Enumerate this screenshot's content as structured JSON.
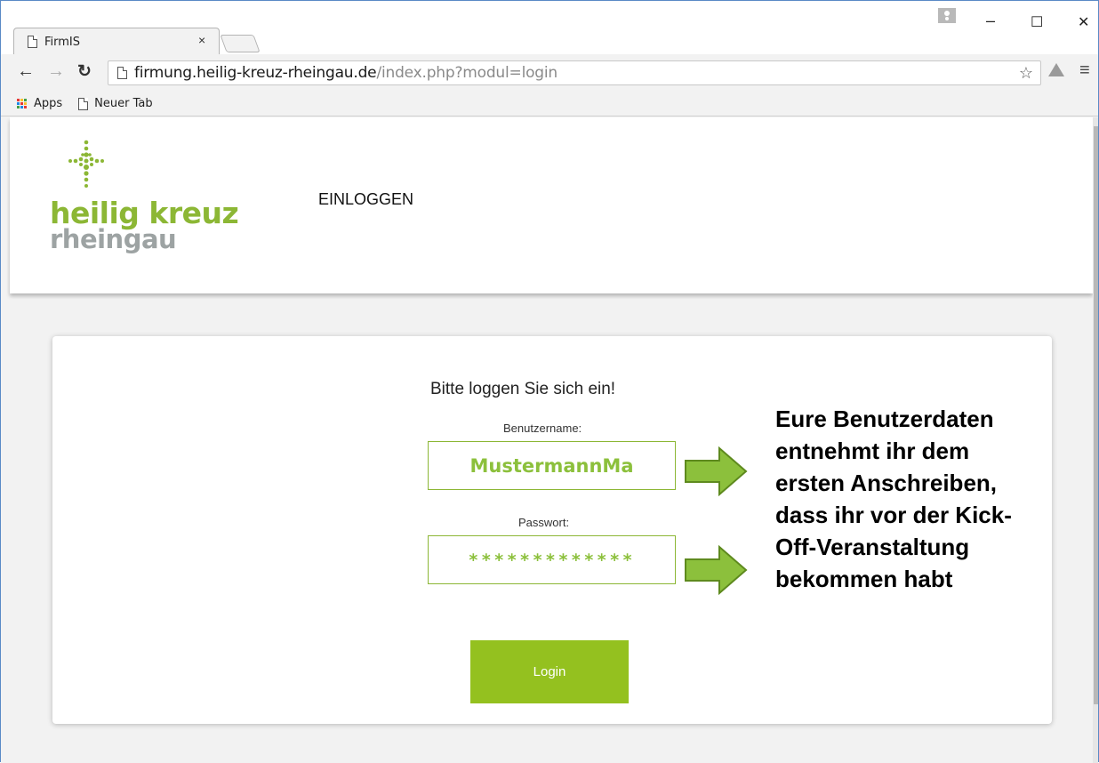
{
  "browser": {
    "tab_title": "FirmIS",
    "tab_close": "×",
    "window_controls": {
      "minimize": "–",
      "maximize": "☐",
      "close": "✕"
    },
    "url_host": "firmung.heilig-kreuz-rheingau.de",
    "url_path": "/index.php?modul=login",
    "bookmarks": [
      {
        "label": "Apps",
        "icon": "apps-grid-icon"
      },
      {
        "label": "Neuer Tab",
        "icon": "page-icon"
      }
    ],
    "apps_colors": [
      "#e53935",
      "#fbc02d",
      "#43a047",
      "#1e88e5",
      "#e53935",
      "#fbc02d",
      "#43a047",
      "#1e88e5",
      "#e53935"
    ]
  },
  "site": {
    "logo_line1": "heilig kreuz",
    "logo_line2": "rheingau",
    "nav_item": "EINLOGGEN",
    "brand_green": "#8cb735",
    "brand_gray": "#9da3a3"
  },
  "login": {
    "heading": "Bitte loggen Sie sich ein!",
    "username_label": "Benutzername:",
    "username_value": "MustermannMa",
    "password_label": "Passwort:",
    "password_value": "*************",
    "button_label": "Login",
    "button_color": "#94c11f"
  },
  "annotation": {
    "text": "Eure Benutzerdaten\nentnehmt ihr dem\nersten Anschreiben,\ndass ihr vor der Kick-\nOff-Veranstaltung\nbekommen habt",
    "arrow_color": "#8cc03c"
  }
}
